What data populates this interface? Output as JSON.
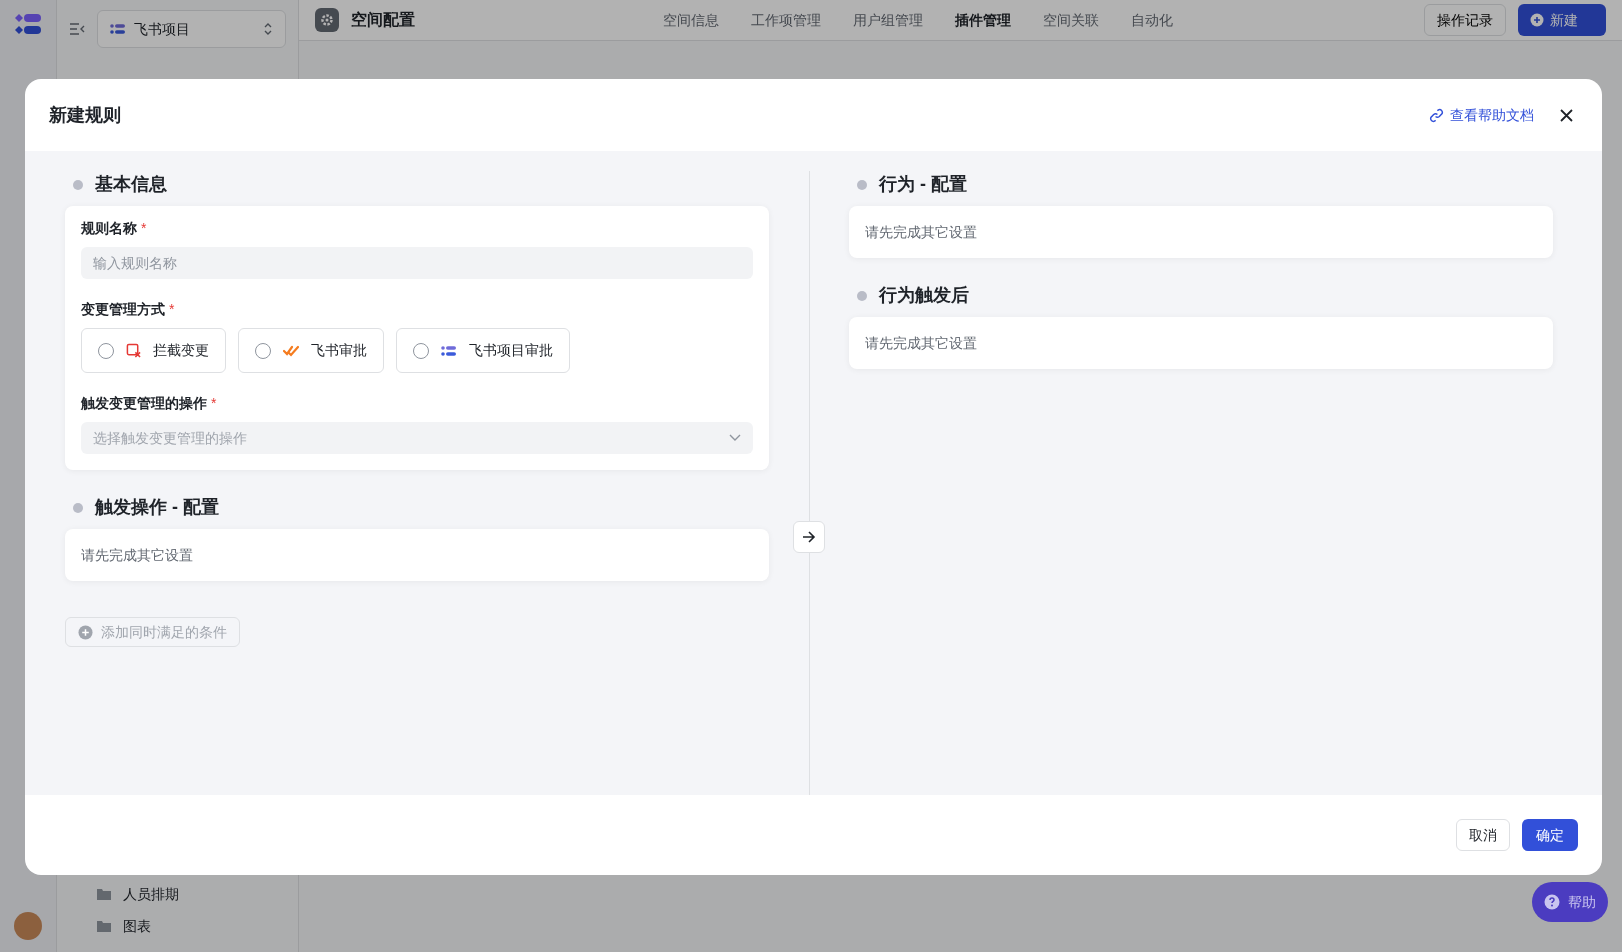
{
  "app": {
    "project_select": "飞书项目",
    "page_title": "空间配置",
    "nav_tabs": [
      {
        "label": "空间信息",
        "selected": false
      },
      {
        "label": "工作项管理",
        "selected": false
      },
      {
        "label": "用户组管理",
        "selected": false
      },
      {
        "label": "插件管理",
        "selected": true
      },
      {
        "label": "空间关联",
        "selected": false
      },
      {
        "label": "自动化",
        "selected": false
      }
    ],
    "history_button": "操作记录",
    "new_button": "新建",
    "sidebar_items": [
      "人员排期",
      "图表"
    ],
    "help_button": "帮助"
  },
  "dialog": {
    "title": "新建规则",
    "help_link": "查看帮助文档",
    "basic_section": {
      "title": "基本信息",
      "rule_name": {
        "label": "规则名称",
        "required_mark": "*",
        "placeholder": "输入规则名称"
      },
      "mode": {
        "label": "变更管理方式",
        "required_mark": "*",
        "options": [
          {
            "kind": "intercept",
            "label": "拦截变更",
            "selected": false
          },
          {
            "kind": "approval",
            "label": "飞书审批",
            "selected": false
          },
          {
            "kind": "project",
            "label": "飞书项目审批",
            "selected": false
          }
        ]
      },
      "trigger": {
        "label": "触发变更管理的操作",
        "required_mark": "*",
        "placeholder": "选择触发变更管理的操作"
      }
    },
    "trigger_section": {
      "title": "触发操作 - 配置",
      "hint": "请先完成其它设置"
    },
    "add_condition": "添加同时满足的条件",
    "action_section": {
      "title": "行为 - 配置",
      "hint": "请先完成其它设置"
    },
    "after_section": {
      "title": "行为触发后",
      "hint": "请先完成其它设置"
    },
    "cancel": "取消",
    "confirm": "确定"
  }
}
